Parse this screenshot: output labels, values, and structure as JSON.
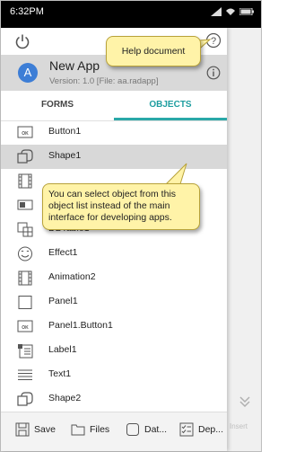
{
  "status_bar": {
    "time": "6:32PM"
  },
  "app": {
    "avatar_letter": "A",
    "name": "New App",
    "version_line": "Version: 1.0  [File: aa.radapp]"
  },
  "tabs": [
    {
      "label": "FORMS",
      "selected": false
    },
    {
      "label": "OBJECTS",
      "selected": true
    }
  ],
  "objects": [
    {
      "label": "Button1",
      "icon": "button-icon"
    },
    {
      "label": "Shape1",
      "icon": "shape-icon",
      "selected": true
    },
    {
      "label": "",
      "icon": "film-icon"
    },
    {
      "label": "",
      "icon": "toggle-icon"
    },
    {
      "label": "",
      "icon": "database-icon"
    },
    {
      "label": "Effect1",
      "icon": "smiley-icon"
    },
    {
      "label": "Animation2",
      "icon": "film-icon"
    },
    {
      "label": "Panel1",
      "icon": "panel-icon"
    },
    {
      "label": "Panel1.Button1",
      "icon": "button-icon"
    },
    {
      "label": "Label1",
      "icon": "label-icon"
    },
    {
      "label": "Text1",
      "icon": "text-lines-icon"
    },
    {
      "label": "Shape2",
      "icon": "shape-icon"
    }
  ],
  "partial_label": "DBTable1",
  "bottom_bar": {
    "save": "Save",
    "files": "Files",
    "data": "Dat...",
    "dep": "Dep..."
  },
  "right_panel": {
    "insert_label": "Insert"
  },
  "callouts": {
    "help": "Help document",
    "objects": "You can select object from this object list instead of the main interface for developing apps."
  },
  "colors": {
    "accent": "#2aa8a8",
    "callout_fill": "#fff3a8",
    "avatar": "#3d7ed6",
    "header_gray": "#d9d9d9"
  }
}
